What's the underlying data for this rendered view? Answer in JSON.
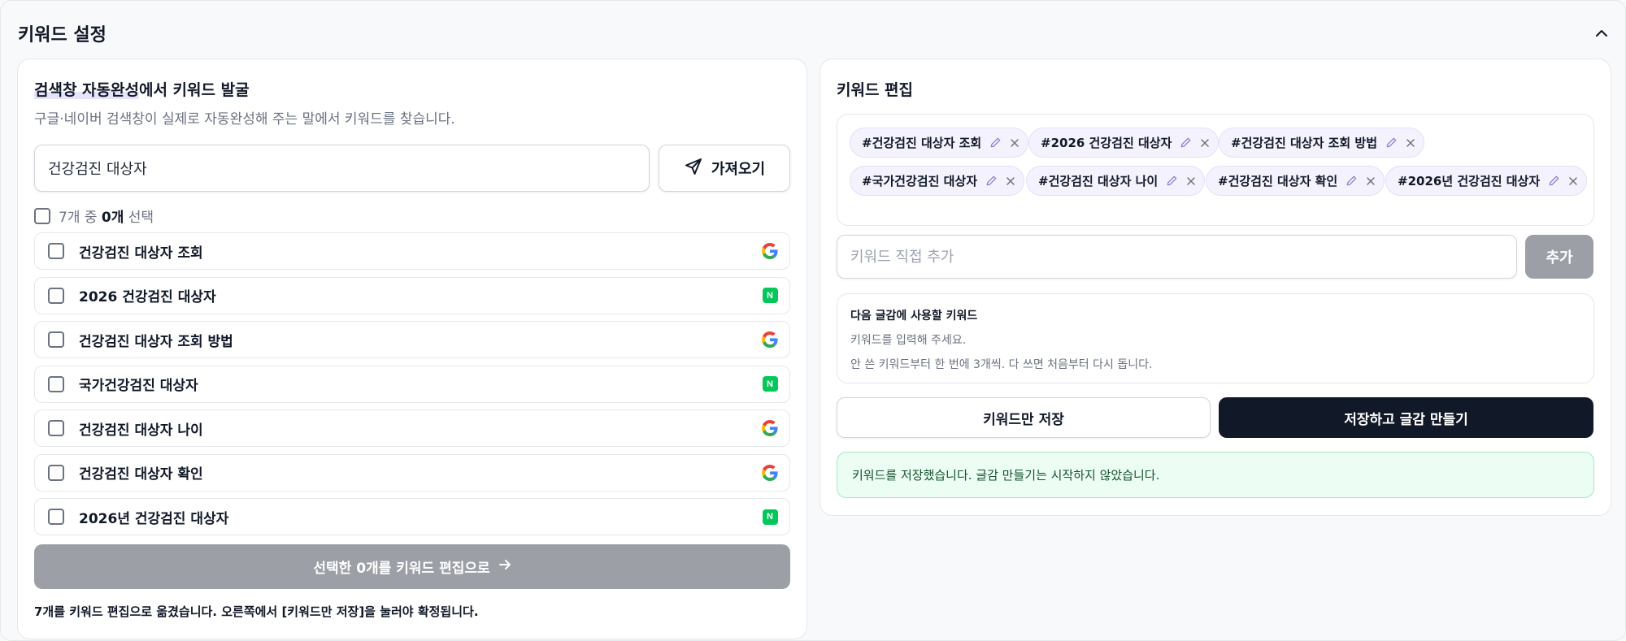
{
  "section": {
    "title": "키워드 설정",
    "collapse_icon": "chevron-up-icon"
  },
  "discover": {
    "title_highlight": "검색창 자동완성",
    "title_rest": "에서 키워드 발굴",
    "subtitle": "구글·네이버 검색창이 실제로 자동완성해 주는 말에서 키워드를 찾습니다.",
    "search_value": "건강검진 대상자",
    "fetch_label": "가져오기",
    "select_prefix": "7개 중 ",
    "select_count": "0개",
    "select_suffix": " 선택",
    "items": [
      {
        "label": "건강검진 대상자 조회",
        "source": "google"
      },
      {
        "label": "2026 건강검진 대상자",
        "source": "naver"
      },
      {
        "label": "건강검진 대상자 조회 방법",
        "source": "google"
      },
      {
        "label": "국가건강검진 대상자",
        "source": "naver"
      },
      {
        "label": "건강검진 대상자 나이",
        "source": "google"
      },
      {
        "label": "건강검진 대상자 확인",
        "source": "google"
      },
      {
        "label": "2026년 건강검진 대상자",
        "source": "naver"
      }
    ],
    "naver_badge": "N",
    "move_label": "선택한 0개를 키워드 편집으로",
    "note": "7개를 키워드 편집으로 옮겼습니다. 오른쪽에서 [키워드만 저장]을 눌러야 확정됩니다."
  },
  "editor": {
    "title": "키워드 편집",
    "chips": [
      "#건강검진 대상자 조회",
      "#2026 건강검진 대상자",
      "#건강검진 대상자 조회 방법",
      "#국가건강검진 대상자",
      "#건강검진 대상자 나이",
      "#건강검진 대상자 확인",
      "#2026년 건강검진 대상자"
    ],
    "add_placeholder": "키워드 직접 추가",
    "add_label": "추가",
    "info_title": "다음 글감에 사용할 키워드",
    "info_line1": "키워드를 입력해 주세요.",
    "info_line2": "안 쓴 키워드부터 한 번에 3개씩. 다 쓰면 처음부터 다시 돕니다.",
    "save_label": "키워드만 저장",
    "save_make_label": "저장하고 글감 만들기",
    "success_msg": "키워드를 저장했습니다. 글감 만들기는 시작하지 않았습니다."
  },
  "colors": {
    "primary_dark": "#111827",
    "disabled": "#9ca0a6",
    "chip_bg": "#f4f2fd",
    "success_bg": "#ecfdf3",
    "naver_green": "#03c75a"
  }
}
